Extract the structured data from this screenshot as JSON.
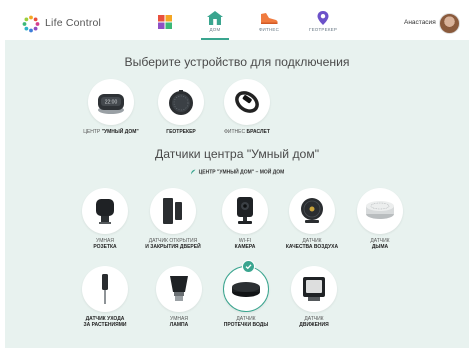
{
  "header": {
    "app_name": "Life Control",
    "nav": [
      {
        "label": "",
        "icon": "dashboard-icon"
      },
      {
        "label": "ДОМ",
        "icon": "home-icon",
        "active": true
      },
      {
        "label": "ФИТНЕС",
        "icon": "sneaker-icon"
      },
      {
        "label": "ГЕОТРЕКЕР",
        "icon": "location-pin-icon"
      }
    ],
    "user_name": "Анастасия"
  },
  "section1": {
    "title": "Выберите устройство для подключения",
    "devices": [
      {
        "prefix": "ЦЕНТР",
        "name": "\"УМНЫЙ ДОМ\"",
        "icon": "smart-home-hub-icon"
      },
      {
        "prefix": "",
        "name": "ГЕОТРЕКЕР",
        "icon": "geotracker-icon"
      },
      {
        "prefix": "ФИТНЕС",
        "name": "БРАСЛЕТ",
        "icon": "fitness-bracelet-icon"
      }
    ]
  },
  "section2": {
    "title": "Датчики центра \"Умный дом\"",
    "hub_label": "ЦЕНТР \"УМНЫЙ ДОМ\" – МОЙ ДОМ",
    "sensors": [
      {
        "line1": "УМНАЯ",
        "line2": "РОЗЕТКА",
        "icon": "smart-socket-icon"
      },
      {
        "line1": "ДАТЧИК ОТКРЫТИЯ",
        "line2": "И ЗАКРЫТИЯ ДВЕРЕЙ",
        "icon": "door-sensor-icon"
      },
      {
        "line1": "WI-FI",
        "line2": "КАМЕРА",
        "icon": "wifi-camera-icon"
      },
      {
        "line1": "ДАТЧИК",
        "line2": "КАЧЕСТВА ВОЗДУХА",
        "icon": "air-quality-sensor-icon"
      },
      {
        "line1": "ДАТЧИК",
        "line2": "ДЫМА",
        "icon": "smoke-detector-icon"
      },
      {
        "line1": "ДАТЧИК УХОДА",
        "line2": "ЗА РАСТЕНИЯМИ",
        "icon": "plant-sensor-icon"
      },
      {
        "line1": "УМНАЯ",
        "line2": "ЛАМПА",
        "icon": "smart-lamp-icon"
      },
      {
        "line1": "ДАТЧИК",
        "line2": "ПРОТЕЧКИ ВОДЫ",
        "icon": "water-leak-sensor-icon",
        "selected": true
      },
      {
        "line1": "ДАТЧИК",
        "line2": "ДВИЖЕНИЯ",
        "icon": "motion-sensor-icon"
      }
    ]
  }
}
